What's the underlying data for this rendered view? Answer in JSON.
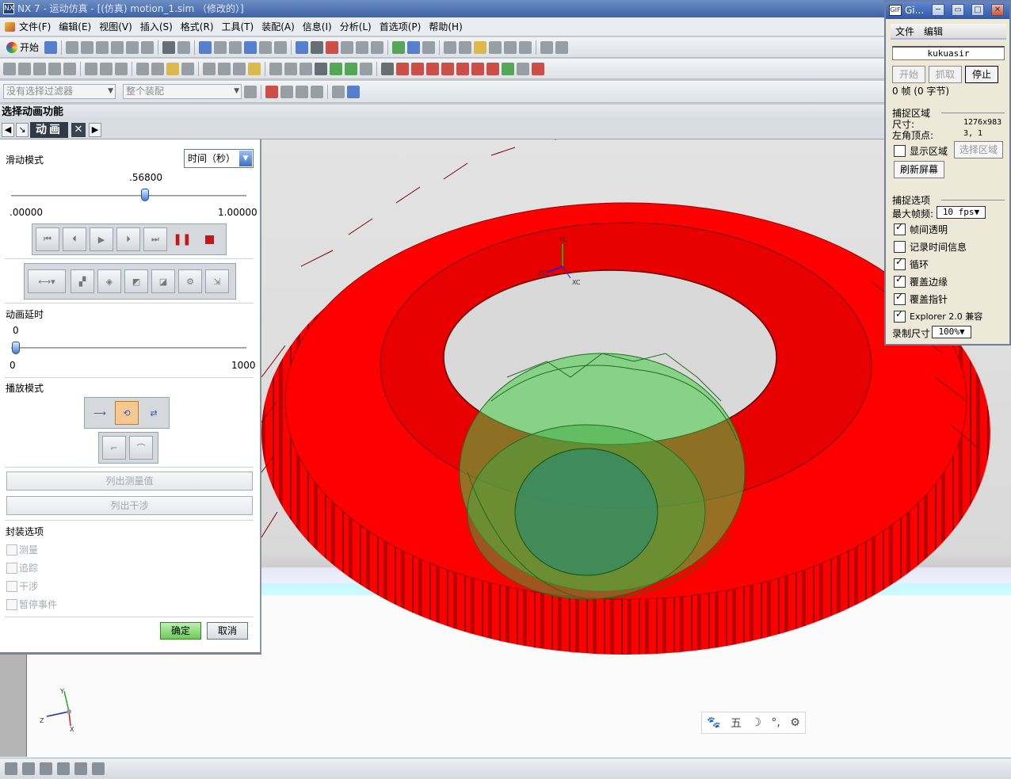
{
  "window": {
    "title": "NX 7 - 运动仿真 - [(仿真) motion_1.sim （修改的）]",
    "logo": "NX"
  },
  "menu": [
    "文件(F)",
    "编辑(E)",
    "视图(V)",
    "插入(S)",
    "格式(R)",
    "工具(T)",
    "装配(A)",
    "信息(I)",
    "分析(L)",
    "首选项(P)",
    "帮助(H)"
  ],
  "toolbar": {
    "start_label": "开始",
    "filter_placeholder": "没有选择过滤器",
    "assembly_combo": "整个装配"
  },
  "section_title": "选择动画功能",
  "tab": {
    "label": "动画"
  },
  "panel": {
    "slide_mode_label": "滑动模式",
    "time_combo": "时间（秒）",
    "slider_value": ".56800",
    "slider_value_fraction": 0.568,
    "slider_min": ".00000",
    "slider_max": "1.00000",
    "delay_label": "动画延时",
    "delay_value": "0",
    "delay_min": "0",
    "delay_max": "1000",
    "play_mode_label": "播放模式",
    "list_measure": "列出测量值",
    "list_interference": "列出干涉",
    "pack_options_label": "封装选项",
    "pack_options": [
      "测量",
      "追踪",
      "干涉",
      "暂停事件"
    ],
    "ok": "确定",
    "cancel": "取消"
  },
  "gifcam": {
    "title": "Gi...",
    "menu": [
      "文件",
      "编辑"
    ],
    "name": "kukuasir",
    "btn_start": "开始",
    "btn_grab": "抓取",
    "btn_stop": "停止",
    "frames": "0 帧 (0 字节)",
    "capture_area": "捕捉区域",
    "size_label": "尺寸:",
    "size_value": "1276x983",
    "topleft_label": "左角顶点:",
    "topleft_value": "3, 1",
    "show_area": "显示区域",
    "select_area": "选择区域",
    "refresh": "刷新屏幕",
    "capture_opts": "捕捉选项",
    "max_fps_label": "最大帧频:",
    "max_fps": "10 fps",
    "opts": [
      {
        "label": "帧间透明",
        "checked": true
      },
      {
        "label": "记录时间信息",
        "checked": false
      },
      {
        "label": "循环",
        "checked": true
      },
      {
        "label": "覆盖边缘",
        "checked": true
      },
      {
        "label": "覆盖指针",
        "checked": true
      },
      {
        "label": "Explorer 2.0 兼容",
        "checked": true
      }
    ],
    "rec_size_label": "录制尺寸",
    "rec_size": "100%"
  },
  "ime": {
    "mode": "五"
  },
  "axes": {
    "yc": "YC",
    "xc": "XC",
    "zc": "ZC",
    "y": "Y",
    "x": "X",
    "z": "Z"
  },
  "colors": {
    "gear_red": "#ff0000",
    "pinion_green": "#55cc55",
    "accent": "#3d6cc6"
  }
}
